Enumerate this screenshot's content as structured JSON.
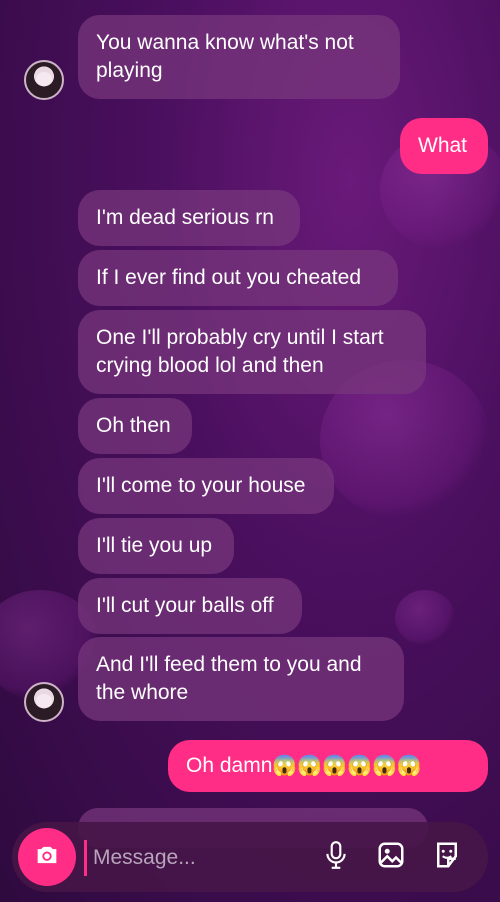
{
  "messages": [
    {
      "text": "You wanna know what's not playing"
    },
    {
      "text": "What"
    },
    {
      "text": "I'm dead serious rn"
    },
    {
      "text": "If I ever find out you cheated"
    },
    {
      "text": "One I'll probably cry until I start crying blood lol and then"
    },
    {
      "text": "Oh then"
    },
    {
      "text": "I'll come to your house"
    },
    {
      "text": "I'll tie you up"
    },
    {
      "text": "I'll cut your balls off"
    },
    {
      "text": "And I'll feed them to you and the whore"
    },
    {
      "text": "Oh damn",
      "emojis": "😱😱😱😱😱😱"
    }
  ],
  "composer": {
    "placeholder": "Message..."
  },
  "icons": {
    "camera": "camera-icon",
    "mic": "microphone-icon",
    "gallery": "image-icon",
    "sticker": "sticker-icon"
  },
  "colors": {
    "accent": "#ff2d86",
    "bubble": "#78377d"
  }
}
